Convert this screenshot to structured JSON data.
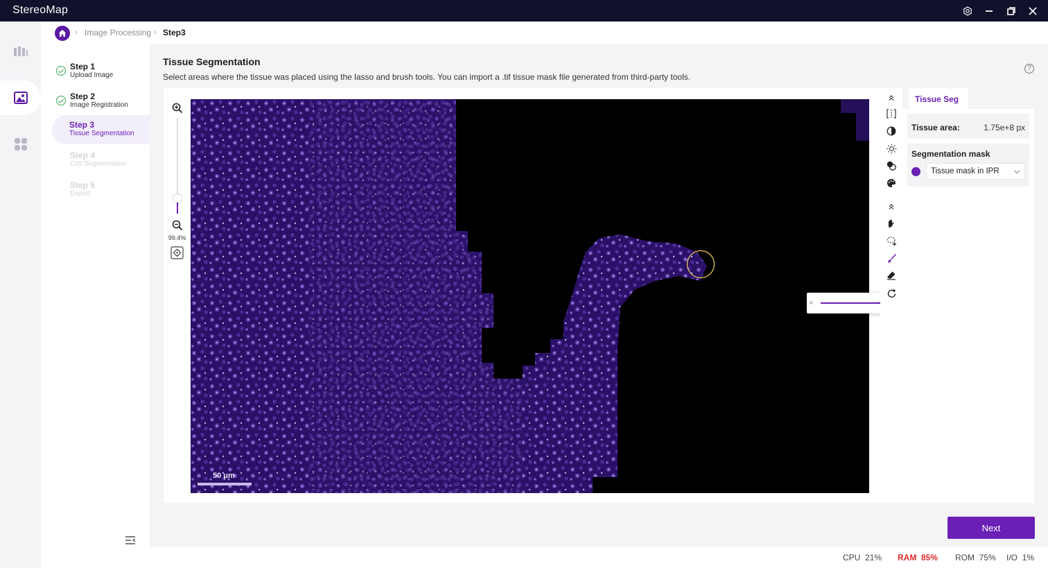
{
  "app": {
    "title": "StereoMap"
  },
  "breadcrumb": {
    "items": [
      "Image Processing",
      "Step3"
    ]
  },
  "steps": [
    {
      "title": "Step 1",
      "subtitle": "Upload Image",
      "state": "done"
    },
    {
      "title": "Step 2",
      "subtitle": "Image Registration",
      "state": "done"
    },
    {
      "title": "Step 3",
      "subtitle": "Tissue Segmentation",
      "state": "current"
    },
    {
      "title": "Step 4",
      "subtitle": "Cell Segmentation",
      "state": "disabled"
    },
    {
      "title": "Step 5",
      "subtitle": "Export",
      "state": "disabled"
    }
  ],
  "page": {
    "title": "Tissue Segmentation",
    "description": "Select areas where the tissue was placed using the lasso and brush tools. You can import a .tif tissue mask file generated from third-party tools."
  },
  "viewer": {
    "zoom_percent": "99.4%",
    "zoom_level": 0.16,
    "scale_bar_label": "50 μm",
    "brush_size": 0.88
  },
  "toolbar": {
    "display_tools": [
      "collapse-up-icon",
      "split-view-icon",
      "contrast-icon",
      "brightness-icon",
      "channel-overlay-icon",
      "palette-icon"
    ],
    "edit_tools": [
      "collapse-up-icon",
      "pan-hand-icon",
      "lasso-add-icon",
      "brush-icon",
      "eraser-icon",
      "reset-icon"
    ],
    "active_tool": "brush-icon"
  },
  "panel": {
    "tab": "Tissue Seg",
    "tissue_area_label": "Tissue area:",
    "tissue_area_value": "1.75e+8 px",
    "mask_title": "Segmentation mask",
    "mask_select_value": "Tissue mask in IPR"
  },
  "actions": {
    "next_label": "Next"
  },
  "status": {
    "cpu_label": "CPU",
    "cpu_value": "21%",
    "ram_label": "RAM",
    "ram_value": "85%",
    "rom_label": "ROM",
    "rom_value": "75%",
    "io_label": "I/O",
    "io_value": "1%"
  },
  "colors": {
    "accent": "#6a1fb5",
    "titlebar": "#12112b",
    "warning": "#e22c2c",
    "annotation_arrow": "#f0b429"
  }
}
